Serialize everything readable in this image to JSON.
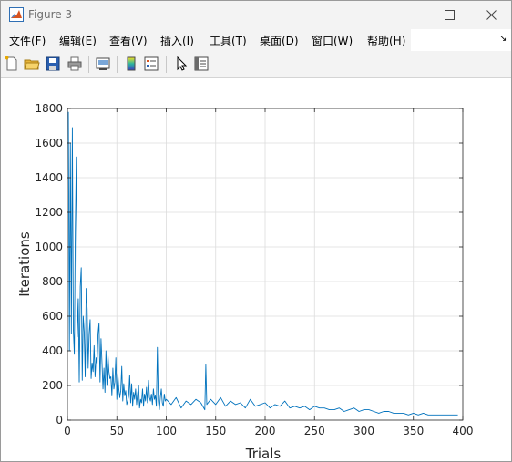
{
  "window": {
    "title": "Figure 3",
    "controls": [
      "minimize-icon",
      "maximize-icon",
      "close-icon"
    ]
  },
  "menu": {
    "items": [
      "文件(F)",
      "编辑(E)",
      "查看(V)",
      "插入(I)",
      "工具(T)",
      "桌面(D)",
      "窗口(W)",
      "帮助(H)"
    ]
  },
  "toolbar": {
    "buttons": [
      "new-figure-icon",
      "open-file-icon",
      "save-icon",
      "print-icon",
      "link-plot-icon",
      "insert-colorbar-icon",
      "insert-legend-icon",
      "edit-plot-icon",
      "property-inspector-icon"
    ]
  },
  "chart_data": {
    "type": "line",
    "title": "",
    "xlabel": "Trials",
    "ylabel": "Iterations",
    "xlim": [
      0,
      400
    ],
    "ylim": [
      0,
      1800
    ],
    "xticks": [
      0,
      50,
      100,
      150,
      200,
      250,
      300,
      350,
      400
    ],
    "yticks": [
      0,
      200,
      400,
      600,
      800,
      1000,
      1200,
      1400,
      1600,
      1800
    ],
    "grid": true,
    "color": "#0072bd",
    "series": [
      {
        "x": [
          1,
          2,
          3,
          4,
          5,
          6,
          7,
          8,
          9,
          10,
          11,
          12,
          13,
          14,
          15,
          16,
          17,
          18,
          19,
          20,
          21,
          22,
          23,
          24,
          25,
          26,
          27,
          28,
          29,
          30,
          31,
          32,
          33,
          34,
          35,
          36,
          37,
          38,
          39,
          40,
          41,
          42,
          43,
          44,
          45,
          46,
          47,
          48,
          49,
          50,
          51,
          52,
          53,
          54,
          55,
          56,
          57,
          58,
          59,
          60,
          61,
          62,
          63,
          64,
          65,
          66,
          67,
          68,
          69,
          70,
          71,
          72,
          73,
          74,
          75,
          76,
          77,
          78,
          79,
          80,
          81,
          82,
          83,
          84,
          85,
          86,
          87,
          88,
          89,
          90,
          91,
          92,
          93,
          94,
          95,
          96,
          97,
          98,
          99,
          100,
          105,
          110,
          115,
          120,
          125,
          130,
          135,
          139,
          140,
          141,
          145,
          150,
          155,
          160,
          165,
          170,
          175,
          180,
          185,
          190,
          195,
          200,
          205,
          210,
          215,
          220,
          225,
          230,
          235,
          240,
          245,
          250,
          255,
          260,
          265,
          270,
          275,
          280,
          285,
          290,
          295,
          300,
          305,
          310,
          315,
          320,
          325,
          330,
          335,
          340,
          345,
          350,
          355,
          360,
          365,
          370,
          375,
          380,
          385,
          390,
          395
        ],
        "values": [
          1780,
          400,
          1600,
          500,
          1690,
          520,
          380,
          1100,
          1520,
          480,
          700,
          220,
          770,
          880,
          230,
          600,
          510,
          250,
          760,
          640,
          300,
          500,
          580,
          240,
          330,
          280,
          430,
          250,
          360,
          320,
          500,
          560,
          220,
          470,
          330,
          180,
          300,
          160,
          400,
          200,
          380,
          280,
          240,
          250,
          140,
          300,
          180,
          220,
          360,
          120,
          270,
          180,
          130,
          170,
          310,
          110,
          210,
          140,
          170,
          90,
          110,
          140,
          260,
          100,
          210,
          80,
          160,
          120,
          180,
          90,
          150,
          200,
          70,
          120,
          100,
          180,
          80,
          150,
          110,
          190,
          100,
          230,
          130,
          110,
          150,
          90,
          180,
          120,
          140,
          80,
          420,
          110,
          60,
          130,
          180,
          100,
          80,
          150,
          110,
          120,
          90,
          130,
          70,
          110,
          90,
          120,
          100,
          60,
          320,
          90,
          120,
          90,
          130,
          80,
          110,
          90,
          100,
          70,
          120,
          80,
          90,
          100,
          70,
          90,
          80,
          110,
          70,
          80,
          70,
          80,
          60,
          80,
          70,
          70,
          60,
          60,
          70,
          50,
          60,
          70,
          50,
          60,
          60,
          50,
          40,
          50,
          50,
          40,
          40,
          40,
          30,
          40,
          30,
          40,
          30,
          30,
          30,
          30,
          30,
          30,
          30
        ]
      }
    ]
  }
}
